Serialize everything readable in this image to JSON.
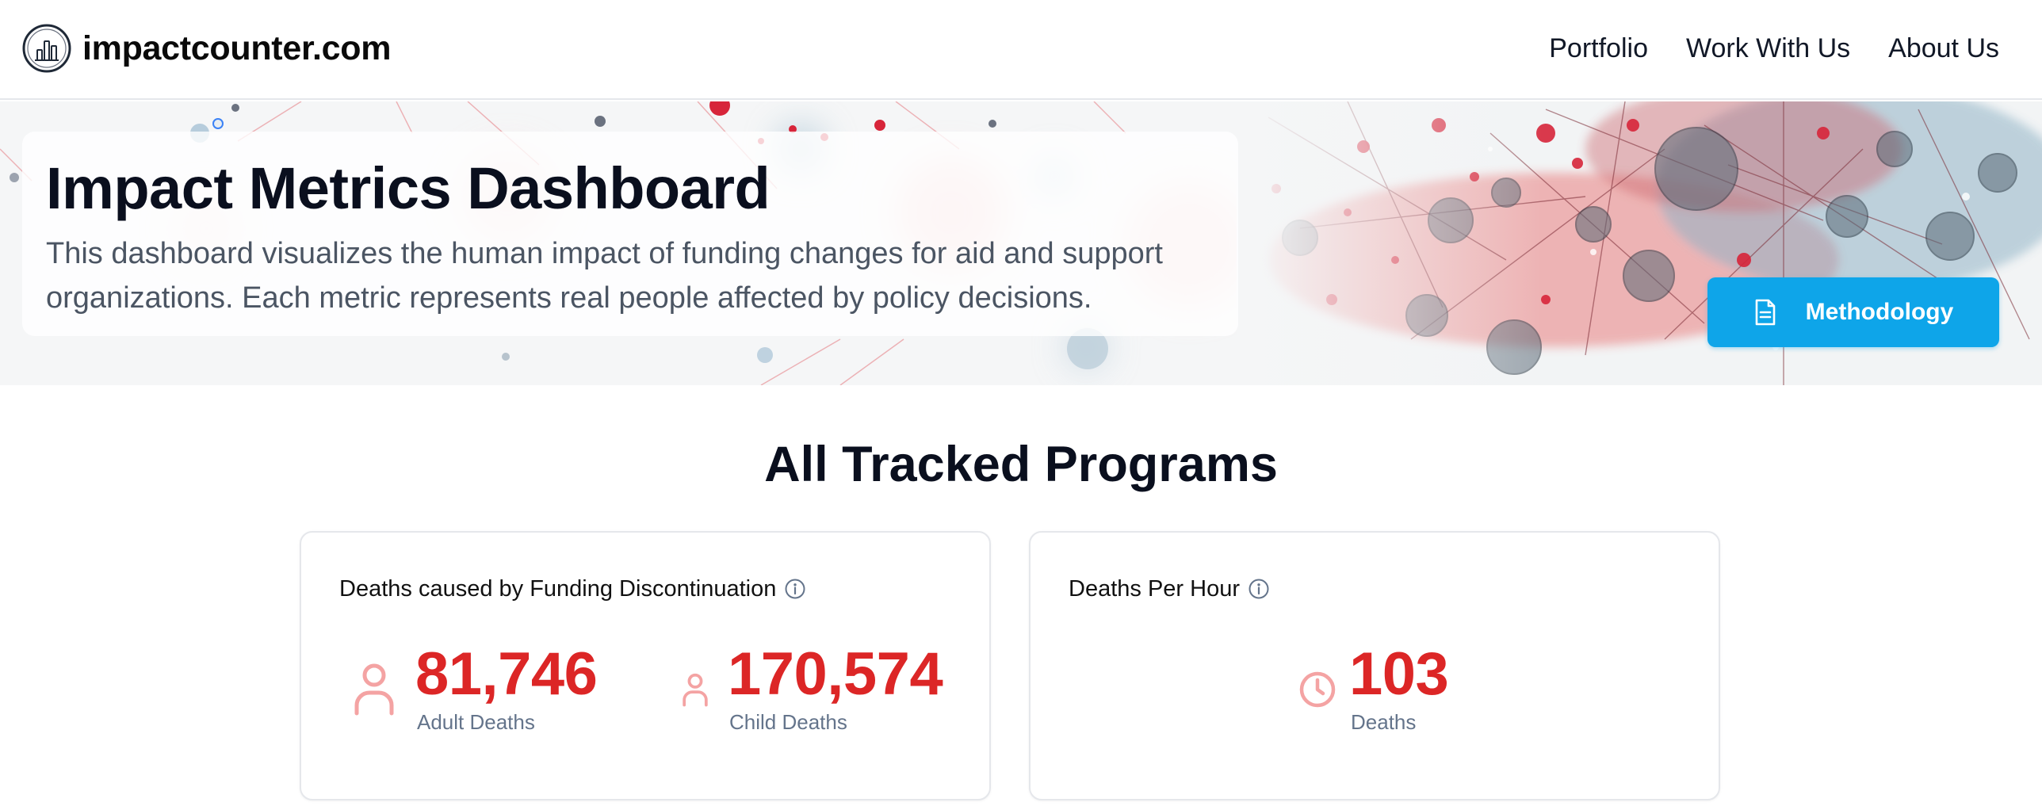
{
  "header": {
    "brand": "impactcounter.com",
    "nav": [
      {
        "label": "Portfolio"
      },
      {
        "label": "Work With Us"
      },
      {
        "label": "About Us"
      }
    ]
  },
  "hero": {
    "title": "Impact Metrics Dashboard",
    "description": "This dashboard visualizes the human impact of funding changes for aid and support organizations. Each metric represents real people affected by policy decisions.",
    "button_label": "Methodology",
    "button_icon": "document-icon"
  },
  "programs": {
    "title": "All Tracked Programs",
    "cards": [
      {
        "title": "Deaths caused by Funding Discontinuation",
        "info_icon": "info-icon",
        "metrics": [
          {
            "icon": "adult-person-icon",
            "value": "81,746",
            "label": "Adult Deaths"
          },
          {
            "icon": "child-person-icon",
            "value": "170,574",
            "label": "Child Deaths"
          }
        ]
      },
      {
        "title": "Deaths Per Hour",
        "info_icon": "info-icon",
        "metrics": [
          {
            "icon": "clock-icon",
            "value": "103",
            "label": "Deaths"
          }
        ]
      }
    ]
  },
  "colors": {
    "accent_red": "#dc2626",
    "icon_red": "#f4a3a3",
    "button_blue": "#0ea5e9"
  }
}
